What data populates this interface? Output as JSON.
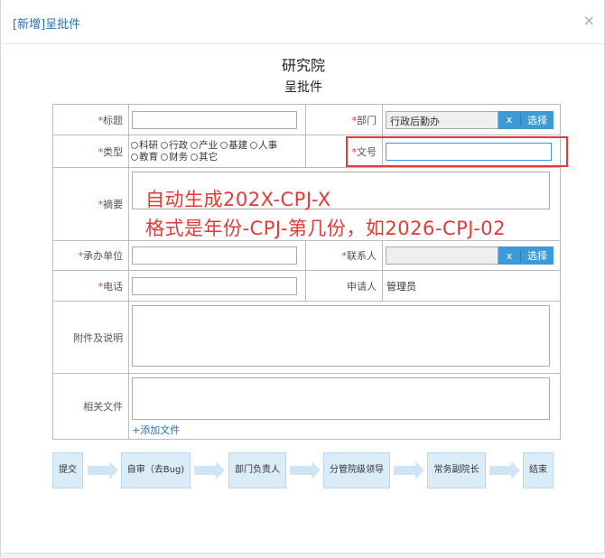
{
  "dialog": {
    "title": "[新增]呈批件",
    "close_glyph": "×"
  },
  "header": {
    "org": "研究院",
    "doc_type": "呈批件"
  },
  "form": {
    "title_label": "标题",
    "dept_label": "部门",
    "dept_value": "行政后勤办",
    "type_label": "类型",
    "type_options": [
      "科研",
      "行政",
      "产业",
      "基建",
      "人事",
      "教育",
      "财务",
      "其它"
    ],
    "docno_label": "文号",
    "summary_label": "摘要",
    "undertaker_label": "承办单位",
    "contact_label": "联系人",
    "phone_label": "电话",
    "applicant_label": "申请人",
    "applicant_value": "管理员",
    "attach_label": "附件及说明",
    "related_label": "相关文件",
    "add_file": "+添加文件",
    "clear_btn": "x",
    "select_btn": "选择",
    "required_mark": "*"
  },
  "annotation": {
    "line1": "自动生成202X-CPJ-X",
    "line2": "格式是年份-CPJ-第几份，如2026-CPJ-02"
  },
  "flow": {
    "steps": [
      "提交",
      "自审（去Bug)",
      "部门负责人",
      "分管院级领导",
      "常务副院长",
      "结束"
    ]
  },
  "colors": {
    "accent": "#3d9ad8",
    "annotation": "#e53935",
    "step_bg": "#d9ecf8"
  }
}
